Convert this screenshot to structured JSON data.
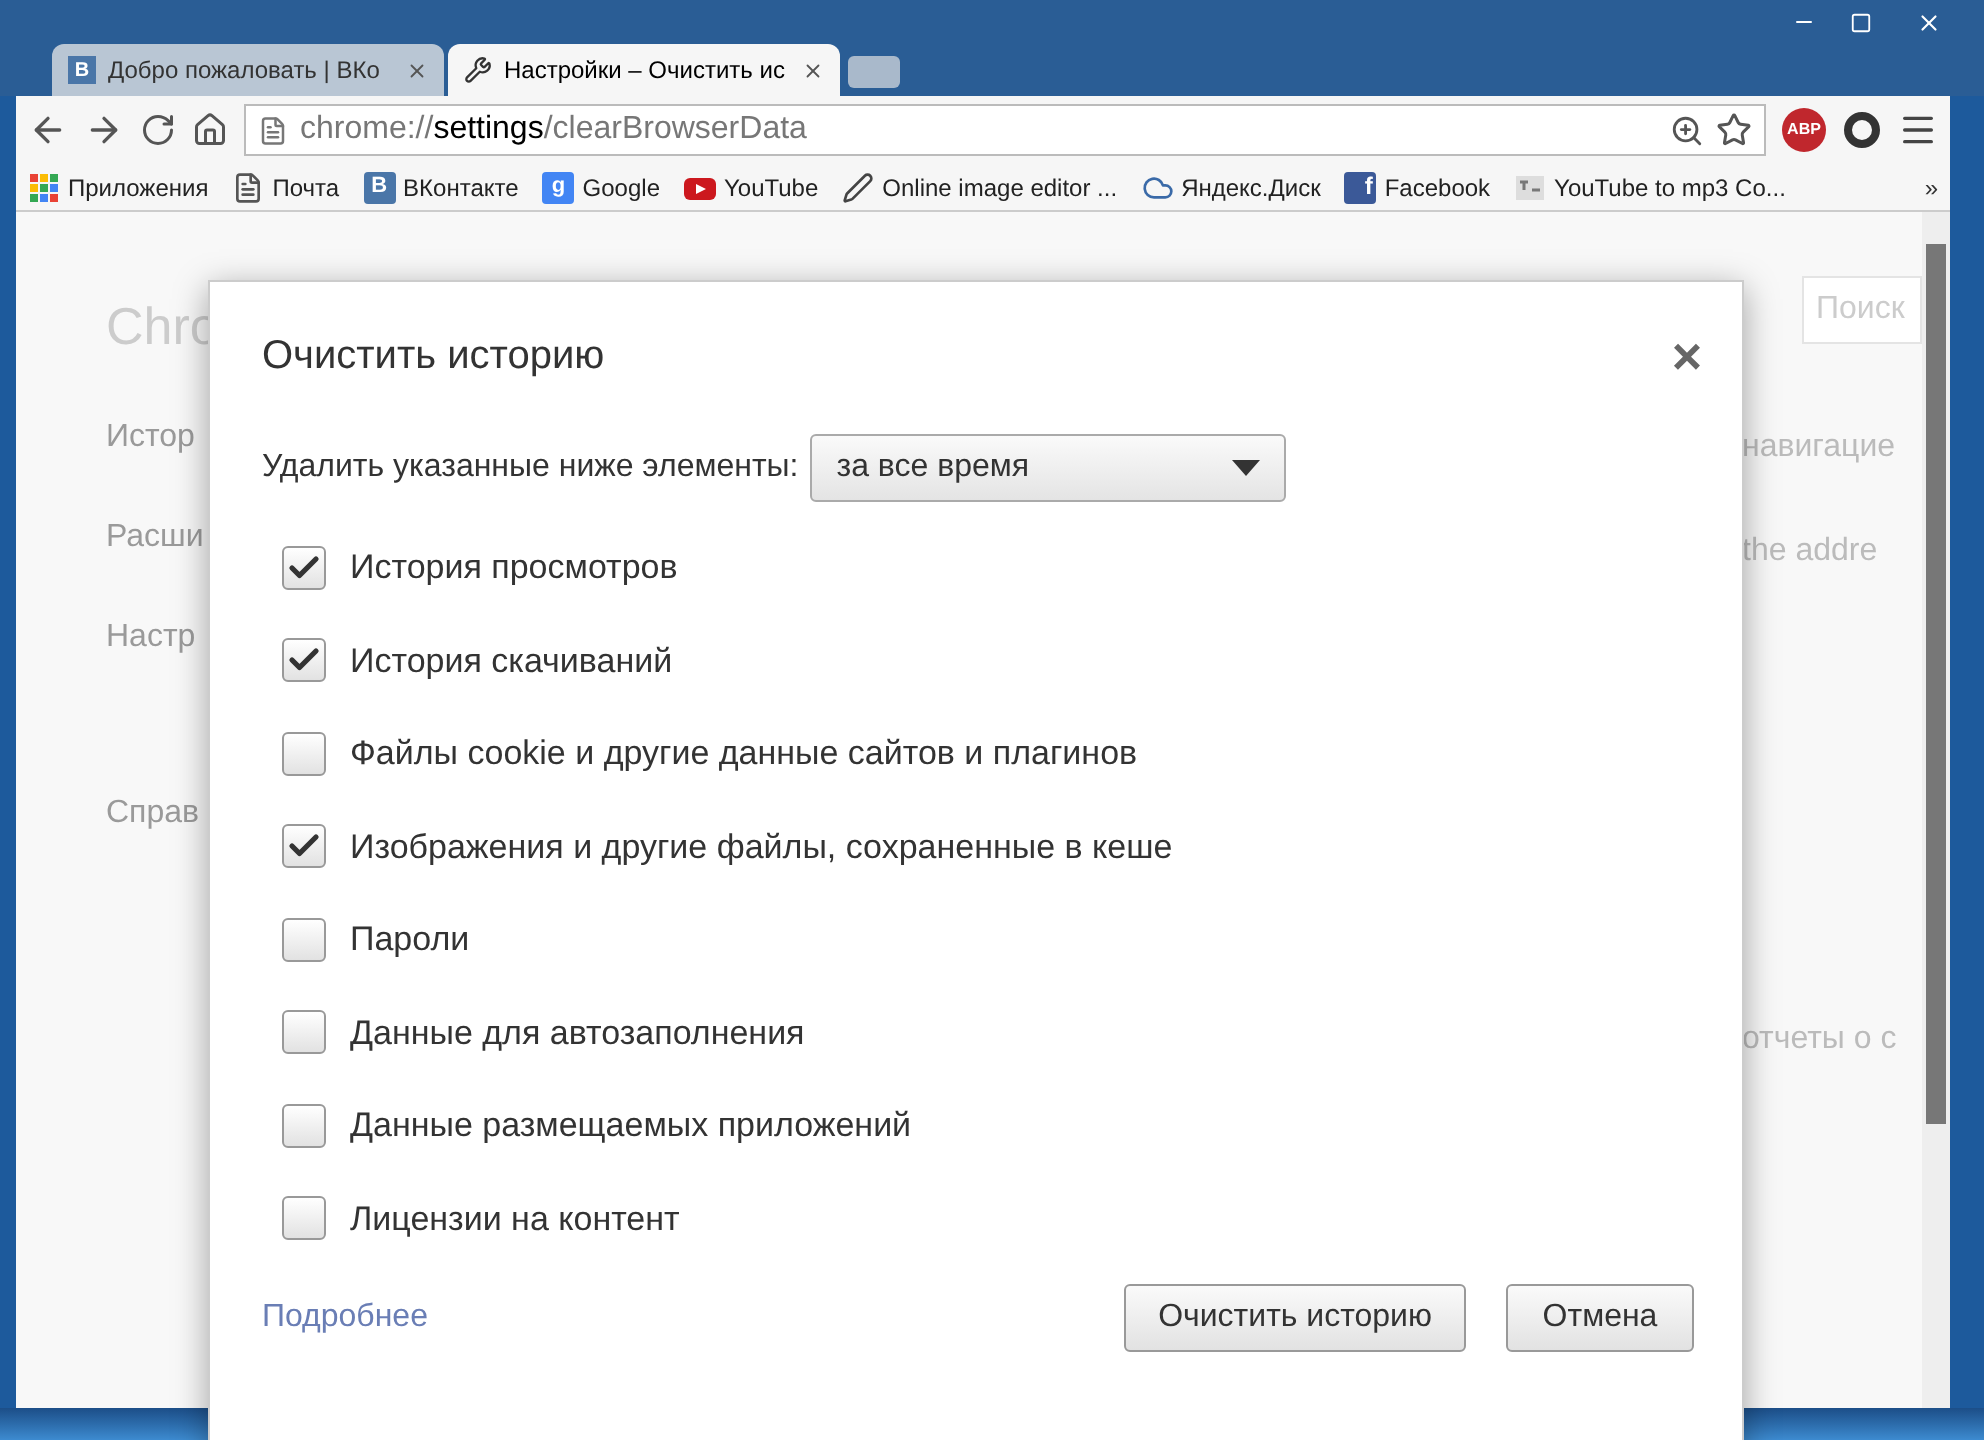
{
  "tabs": [
    {
      "title": "Добро пожаловать | ВКо",
      "selected": false,
      "icon_text": "B"
    },
    {
      "title": "Настройки – Очистить ис",
      "selected": true
    }
  ],
  "adblock_text": "ABP",
  "address": {
    "scheme": "chrome://",
    "host": "settings",
    "path": "/clearBrowserData"
  },
  "bookmarks": [
    {
      "label": "Приложения",
      "kind": "apps"
    },
    {
      "label": "Почта",
      "kind": "page"
    },
    {
      "label": "ВКонтакте",
      "kind": "vk",
      "icon_text": "B"
    },
    {
      "label": "Google",
      "kind": "google",
      "icon_text": "g"
    },
    {
      "label": "YouTube",
      "kind": "youtube"
    },
    {
      "label": "Online image editor ...",
      "kind": "pen"
    },
    {
      "label": "Яндекс.Диск",
      "kind": "disk"
    },
    {
      "label": "Facebook",
      "kind": "facebook",
      "icon_text": "f"
    },
    {
      "label": "YouTube to mp3 Co...",
      "kind": "mp3"
    }
  ],
  "bookmarks_more": "»",
  "settings_page": {
    "title": "Chro",
    "nav": [
      "Истор",
      "Расши",
      "Настр",
      "Справ"
    ],
    "search_placeholder": "Поиск",
    "fragments": [
      "навигацие",
      "the addre",
      "отчеты о с"
    ]
  },
  "dialog": {
    "title": "Очистить историю",
    "close": "×",
    "range_label": "Удалить указанные ниже элементы:",
    "range_value": "за все время",
    "options": [
      {
        "label": "История просмотров",
        "checked": true
      },
      {
        "label": "История скачиваний",
        "checked": true
      },
      {
        "label": "Файлы cookie и другие данные сайтов и плагинов",
        "checked": false
      },
      {
        "label": "Изображения и другие файлы, сохраненные в кеше",
        "checked": true
      },
      {
        "label": "Пароли",
        "checked": false
      },
      {
        "label": "Данные для автозаполнения",
        "checked": false
      },
      {
        "label": "Данные размещаемых приложений",
        "checked": false
      },
      {
        "label": "Лицензии на контент",
        "checked": false
      }
    ],
    "link": "Подробнее",
    "buttons": [
      "Очистить историю",
      "Отмена"
    ]
  }
}
